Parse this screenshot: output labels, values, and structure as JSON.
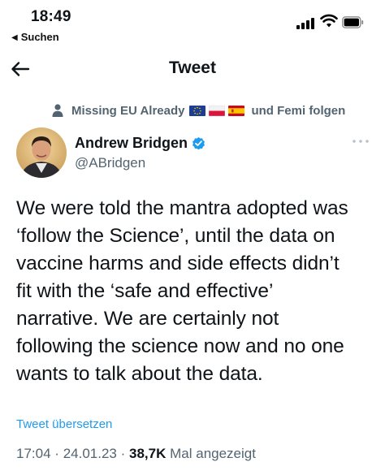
{
  "status_bar": {
    "time": "18:49",
    "back_app": "Suchen"
  },
  "nav": {
    "title": "Tweet"
  },
  "social_context": {
    "text": "Missing EU Already",
    "suffix": "und Femi folgen",
    "flags": [
      "eu-flag",
      "poland-flag",
      "spain-flag"
    ]
  },
  "author": {
    "name": "Andrew Bridgen",
    "handle": "@ABridgen",
    "verified": true
  },
  "tweet": {
    "text": "We were told the mantra adopted was\n‘follow the Science’, until the data on\nvaccine harms and side effects didn’t\nfit with the ‘safe and effective’\nnarrative.  We are certainly not\nfollowing the science now and no one\nwants to talk about the data.",
    "translate_label": "Tweet übersetzen",
    "time": "17:04",
    "date": "24.01.23",
    "separator": "·",
    "views": "38,7K",
    "views_label": "Mal angezeigt"
  },
  "colors": {
    "accent": "#1d9bf0",
    "secondary_text": "#536471",
    "primary_text": "#0f1419"
  },
  "icons": {
    "back": "arrow-left-icon",
    "more": "more-horizontal-icon",
    "verified": "verified-badge-icon",
    "person": "person-icon"
  }
}
